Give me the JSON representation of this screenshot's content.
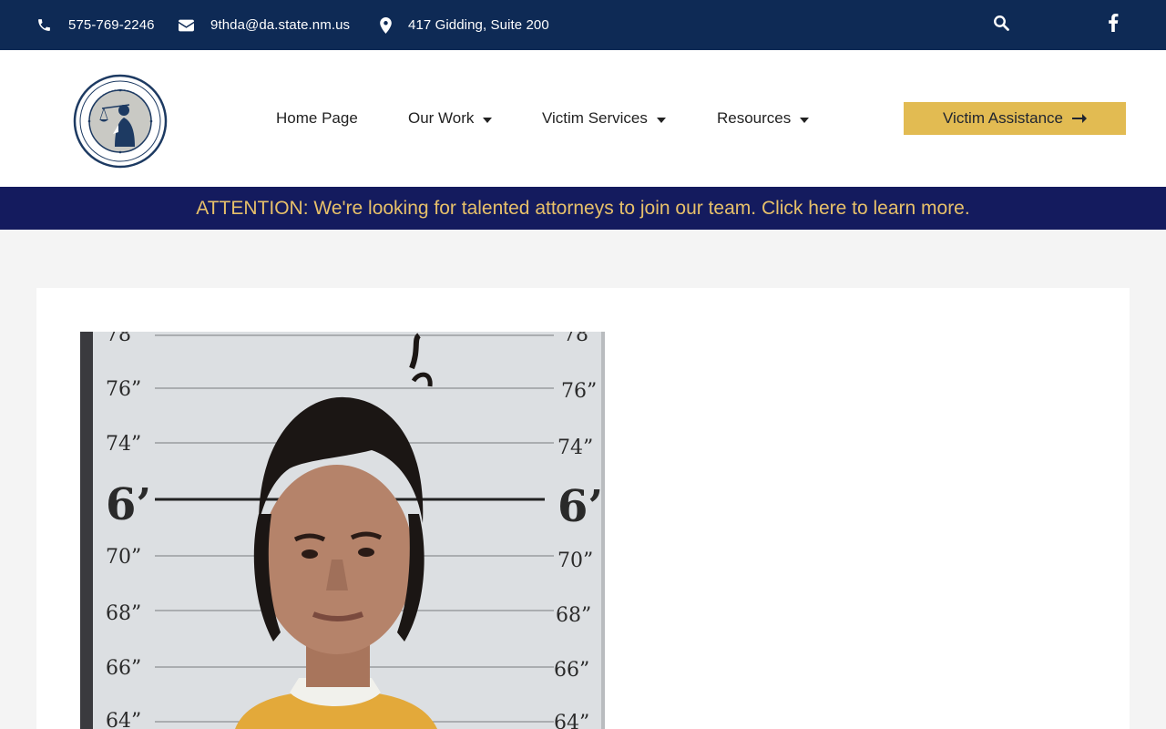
{
  "topbar": {
    "phone": "575-769-2246",
    "email": "9thda@da.state.nm.us",
    "address": "417 Gidding, Suite 200",
    "icons": [
      "phone-icon",
      "envelope-icon",
      "map-pin-icon",
      "search-icon",
      "facebook-icon"
    ]
  },
  "header": {
    "logo_alt": "Ninth Judicial District Attorney - Curry and Roosevelt Counties",
    "nav": [
      {
        "label": "Home Page",
        "has_dropdown": false
      },
      {
        "label": "Our Work",
        "has_dropdown": true
      },
      {
        "label": "Victim Services",
        "has_dropdown": true
      },
      {
        "label": "Resources",
        "has_dropdown": true
      }
    ],
    "cta_label": "Victim Assistance"
  },
  "banner": {
    "text": "ATTENTION: We're looking for talented attorneys to join our team. Click here to learn more."
  },
  "content": {
    "photo_height_labels": [
      "78",
      "76”",
      "74”",
      "6’",
      "70”",
      "68”",
      "66”",
      "64”"
    ]
  },
  "colors": {
    "topbar_bg": "#0e2a55",
    "banner_bg": "#141b5e",
    "banner_text": "#e7c06a",
    "cta_bg": "#e2bb52",
    "page_bg": "#f4f4f4"
  }
}
